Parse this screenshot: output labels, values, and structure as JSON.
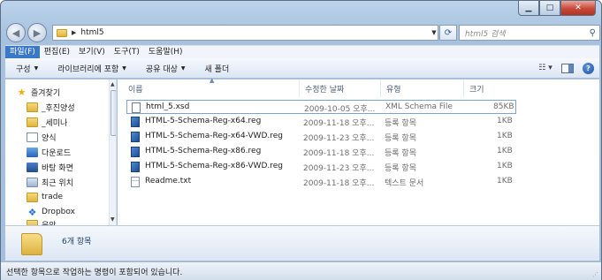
{
  "address": {
    "path": "html5",
    "search_placeholder": "html5 검색"
  },
  "menu": [
    "파일(F)",
    "편집(E)",
    "보기(V)",
    "도구(T)",
    "도움말(H)"
  ],
  "commands": [
    {
      "label": "구성",
      "dropdown": true
    },
    {
      "label": "라이브러리에 포함",
      "dropdown": true
    },
    {
      "label": "공유 대상",
      "dropdown": true
    },
    {
      "label": "새 폴더",
      "dropdown": false
    }
  ],
  "nav": [
    {
      "label": "즐겨찾기",
      "icon": "star-icon"
    },
    {
      "label": "_후진양성",
      "icon": "folder-icon"
    },
    {
      "label": "_세미나",
      "icon": "folder-icon"
    },
    {
      "label": "양식",
      "icon": "document-icon"
    },
    {
      "label": "다운로드",
      "icon": "download-icon"
    },
    {
      "label": "바탕 화면",
      "icon": "desktop-icon"
    },
    {
      "label": "최근 위치",
      "icon": "recent-places-icon"
    },
    {
      "label": "trade",
      "icon": "folder-icon"
    },
    {
      "label": "Dropbox",
      "icon": "dropbox-icon"
    },
    {
      "label": "음악",
      "icon": "folder-icon"
    }
  ],
  "columns": {
    "name": "이름",
    "date": "수정한 날짜",
    "type": "유형",
    "size": "크기"
  },
  "files": [
    {
      "name": "html_5.xsd",
      "date": "2009-10-05 오후...",
      "type": "XML Schema File",
      "size": "85KB",
      "icon": "xsd-file-icon"
    },
    {
      "name": "HTML-5-Schema-Reg-x64.reg",
      "date": "2009-11-18 오후...",
      "type": "등록 항목",
      "size": "1KB",
      "icon": "registry-file-icon"
    },
    {
      "name": "HTML-5-Schema-Reg-x64-VWD.reg",
      "date": "2009-11-23 오후...",
      "type": "등록 항목",
      "size": "1KB",
      "icon": "registry-file-icon"
    },
    {
      "name": "HTML-5-Schema-Reg-x86.reg",
      "date": "2009-11-18 오후...",
      "type": "등록 항목",
      "size": "1KB",
      "icon": "registry-file-icon"
    },
    {
      "name": "HTML-5-Schema-Reg-x86-VWD.reg",
      "date": "2009-11-23 오후...",
      "type": "등록 항목",
      "size": "1KB",
      "icon": "registry-file-icon"
    },
    {
      "name": "Readme.txt",
      "date": "2009-11-18 오후...",
      "type": "텍스트 문서",
      "size": "1KB",
      "icon": "text-file-icon"
    }
  ],
  "details": {
    "count": "6개 항목"
  },
  "status": {
    "text": "선택한 항목으로 작업하는 명령이 포함되어 있습니다."
  }
}
